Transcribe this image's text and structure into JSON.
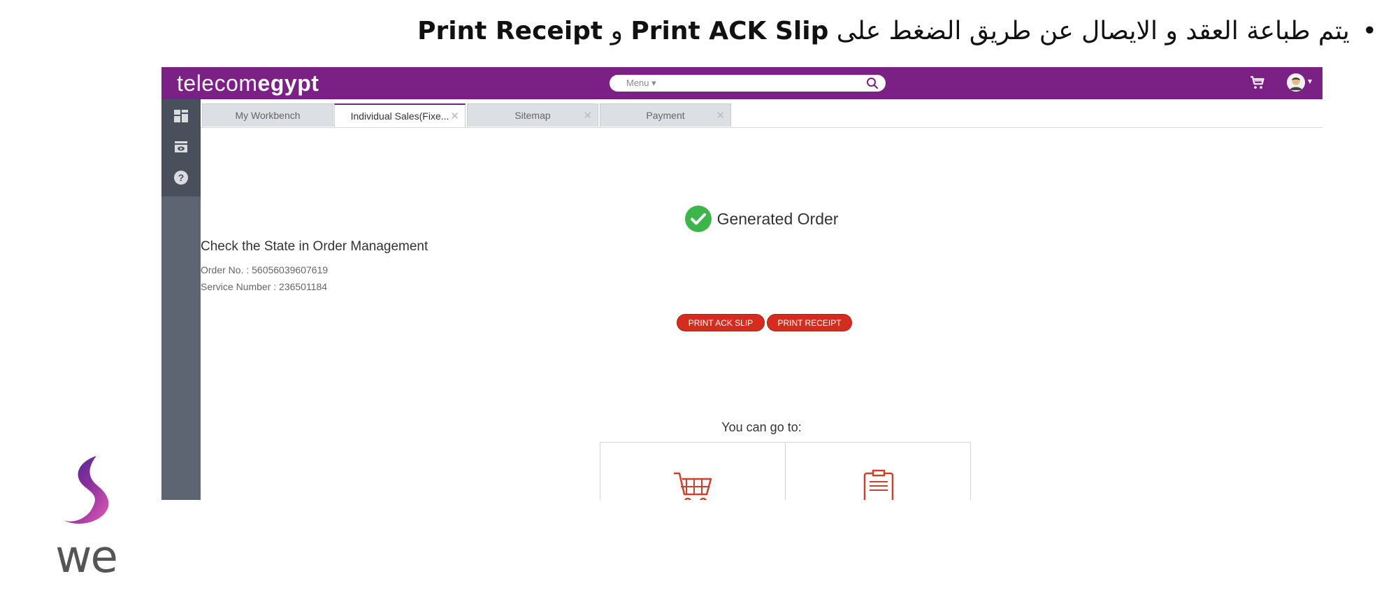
{
  "caption": {
    "prefix": "يتم طباعة العقد و الايصال عن طريق الضغط على ",
    "term1": "Print ACK Slip",
    "joiner": " و ",
    "term2": "Print Receipt"
  },
  "app": {
    "logo_thin": "telecom",
    "logo_bold": "egypt",
    "search_placeholder": "Menu ▾",
    "tabs": [
      {
        "label": "My Workbench",
        "closable": false
      },
      {
        "label": "Individual Sales(Fixe...",
        "closable": true,
        "active": true
      },
      {
        "label": "Sitemap",
        "closable": true
      },
      {
        "label": "Payment",
        "closable": true
      }
    ],
    "result": {
      "title": "Generated Order",
      "subtitle": "Check the State in Order Management",
      "order_no": "Order No. : 56056039607619",
      "service_number": "Service Number : 236501184",
      "print_ack_label": "PRINT ACK SLIP",
      "print_receipt_label": "PRINT RECEIPT",
      "goto_label": "You can go to:"
    }
  },
  "brand": {
    "we_text": "we",
    "accent_color": "#7b2185",
    "button_color": "#d22d1f",
    "success_color": "#3cb54a"
  },
  "icons": [
    "search-icon",
    "cart-icon",
    "avatar",
    "workbench-icon",
    "preview-icon",
    "help-icon",
    "shopping-cart-icon",
    "clipboard-icon"
  ]
}
